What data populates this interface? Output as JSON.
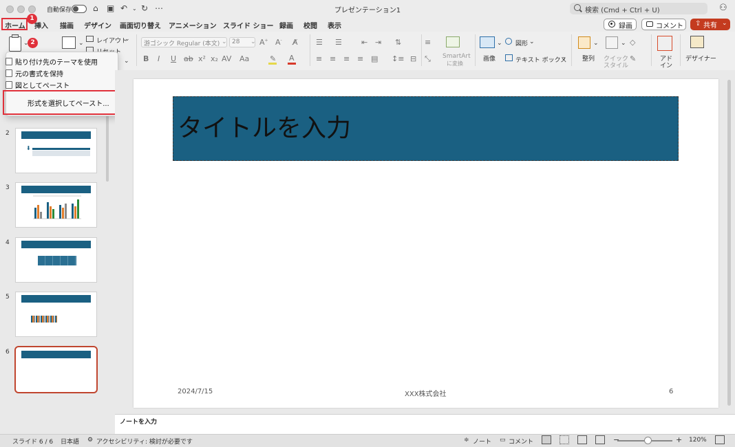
{
  "window": {
    "title": "プレゼンテーション1",
    "autosave_label": "自動保存",
    "search_placeholder": "検索 (Cmd + Ctrl + U)"
  },
  "tabs": [
    "ホーム",
    "挿入",
    "描画",
    "デザイン",
    "画面切り替え",
    "アニメーション",
    "スライド ショー",
    "録画",
    "校閲",
    "表示"
  ],
  "tab_actions": {
    "record": "録画",
    "comment": "コメント",
    "share": "共有"
  },
  "annotations": {
    "step1": "1",
    "step2": "2"
  },
  "ribbon": {
    "layout": "レイアウト",
    "reset": "リセット",
    "font_name": "游ゴシック Regular (本文)",
    "font_size": "28",
    "smartart_line1": "SmartArt",
    "smartart_line2": "に変換",
    "image": "画像",
    "shapes": "図形",
    "textbox": "テキスト ボックス",
    "arrange": "整列",
    "quick_style_line1": "クイック",
    "quick_style_line2": "スタイル",
    "addin_line1": "アド",
    "addin_line2": "イン",
    "designer": "デザイナー"
  },
  "paste_menu": {
    "items": [
      "貼り付け先のテーマを使用",
      "元の書式を保持",
      "図としてペースト"
    ],
    "special": "形式を選択してペースト..."
  },
  "thumbnails": [
    "2",
    "3",
    "4",
    "5",
    "6"
  ],
  "slide": {
    "title": "タイトルを入力",
    "date": "2024/7/15",
    "company": "XXX株式会社",
    "page": "6"
  },
  "notes_placeholder": "ノートを入力",
  "status": {
    "slide_info": "スライド 6 / 6",
    "language": "日本語",
    "accessibility": "アクセシビリティ: 検討が必要です",
    "notes": "ノート",
    "comments": "コメント",
    "zoom": "120%"
  },
  "colors": {
    "accent": "#1a6082",
    "highlight": "#e0303a",
    "share": "#c43b1f"
  }
}
